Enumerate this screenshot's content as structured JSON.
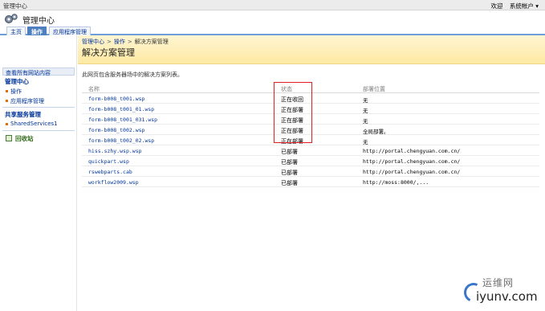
{
  "topbar": {
    "title": "管理中心",
    "welcome": "欢迎",
    "account": "系统帐户 ▾"
  },
  "header": {
    "title": "管理中心"
  },
  "tabs": [
    {
      "label": "主页"
    },
    {
      "label": "操作"
    },
    {
      "label": "应用程序管理"
    }
  ],
  "sidebar": {
    "view_all": "查看所有网站内容",
    "section1": "管理中心",
    "items1": [
      {
        "label": "操作"
      },
      {
        "label": "应用程序管理"
      }
    ],
    "section2": "共享服务管理",
    "items2": [
      {
        "label": "SharedServices1"
      }
    ],
    "recycle": "回收站"
  },
  "breadcrumb": {
    "part1": "管理中心",
    "part2": "操作",
    "part3": "解决方案管理",
    "sep": ">"
  },
  "page": {
    "title": "解决方案管理",
    "description": "此网页包含服务器场中的解决方案列表。"
  },
  "table": {
    "headers": {
      "name": "名称",
      "status": "状态",
      "location": "部署位置"
    },
    "rows": [
      {
        "name": "form-b008_t001.wsp",
        "status": "正在收回",
        "location": "无"
      },
      {
        "name": "form-b008_t001_01.wsp",
        "status": "正在部署",
        "location": "无"
      },
      {
        "name": "form-b008_t001_031.wsp",
        "status": "正在部署",
        "location": "无"
      },
      {
        "name": "form-b008_t002.wsp",
        "status": "正在部署",
        "location": "全局部署。"
      },
      {
        "name": "form-b008_t002_02.wsp",
        "status": "正在部署",
        "location": "无"
      },
      {
        "name": "hiss.szhy.wsp.wsp",
        "status": "已部署",
        "location": "http://portal.chengyuan.com.cn/"
      },
      {
        "name": "quickpart.wsp",
        "status": "已部署",
        "location": "http://portal.chengyuan.com.cn/"
      },
      {
        "name": "rswebparts.cab",
        "status": "已部署",
        "location": "http://portal.chengyuan.com.cn/"
      },
      {
        "name": "workflow2009.wsp",
        "status": "已部署",
        "location": "http://moss:8000/,..."
      }
    ]
  },
  "watermark": {
    "cn": "运维网",
    "en": "iyunv.com"
  }
}
